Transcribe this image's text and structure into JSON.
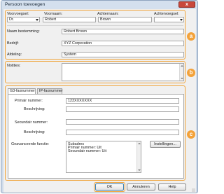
{
  "window": {
    "title": "Persoon toevoegen",
    "close_glyph": "x"
  },
  "name_section": {
    "badge": "a",
    "voorvoegsel_label": "Voorvoegsel:",
    "voornaam_label": "Voornaam:",
    "achternaam_label": "Achternaam:",
    "achtervoegsel_label": "Achtervoegsel:",
    "voorvoegsel_value": "Dr.",
    "voornaam_value": "Robert",
    "achternaam_value": "Brown",
    "achtervoegsel_value": "",
    "naam_bestemming_label": "Naam bestemming:",
    "naam_bestemming_value": "Robert Brown",
    "bedrijf_label": "Bedrijf:",
    "bedrijf_value": "XYZ Corporation",
    "afdeling_label": "Afdeling:",
    "afdeling_value": "System"
  },
  "notes_section": {
    "badge": "b",
    "label": "Notities:",
    "value": ""
  },
  "numbers_section": {
    "badge": "c",
    "tabs": [
      {
        "label": "G3-faxnummer",
        "active": true
      },
      {
        "label": "IP-faxnummer",
        "active": false
      }
    ],
    "primair_label": "Primair nummer:",
    "primair_value": "123XXXXXXX",
    "beschrijving1_label": "Beschrijving:",
    "beschrijving1_value": "",
    "secundair_label": "Secundair nummer:",
    "secundair_value": "",
    "beschrijving2_label": "Beschrijving:",
    "beschrijving2_value": "",
    "geavanceerde_label": "Geavanceerde functie:",
    "advanced_lines": [
      "Subadres",
      "Primair nummer:   Uit",
      "Secundair nummer:  Uit"
    ],
    "instellingen_button": "Instellingen..."
  },
  "footer": {
    "ok": "OK",
    "annuleren": "Annuleren",
    "help": "Help"
  },
  "colors": {
    "highlight": "#f3a23a",
    "titlebar": "#d4e0ee",
    "close": "#c9483b"
  }
}
